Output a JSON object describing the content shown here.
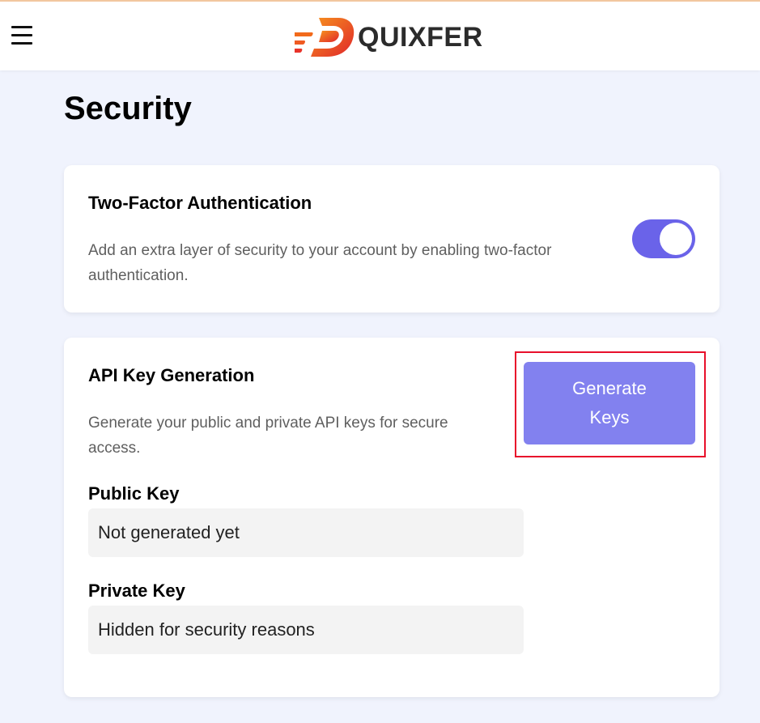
{
  "header": {
    "brand_name": "QUIXFER",
    "menu_icon": "hamburger-menu-icon",
    "logo_icon": "quixfer-logo-icon",
    "brand_colors": [
      "#f26a1b",
      "#e8332a"
    ]
  },
  "page": {
    "title": "Security"
  },
  "two_factor": {
    "title": "Two-Factor Authentication",
    "description": "Add an extra layer of security to your account by enabling two-factor authentication.",
    "enabled": true,
    "toggle_color": "#6a63e9"
  },
  "api_keys": {
    "title": "API Key Generation",
    "description": "Generate your public and private API keys for secure access.",
    "generate_button_label": "Generate Keys",
    "button_color": "#8281ef",
    "highlight_color": "#e8102b",
    "public_key_label": "Public Key",
    "public_key_value": "Not generated yet",
    "private_key_label": "Private Key",
    "private_key_value": "Hidden for security reasons"
  }
}
